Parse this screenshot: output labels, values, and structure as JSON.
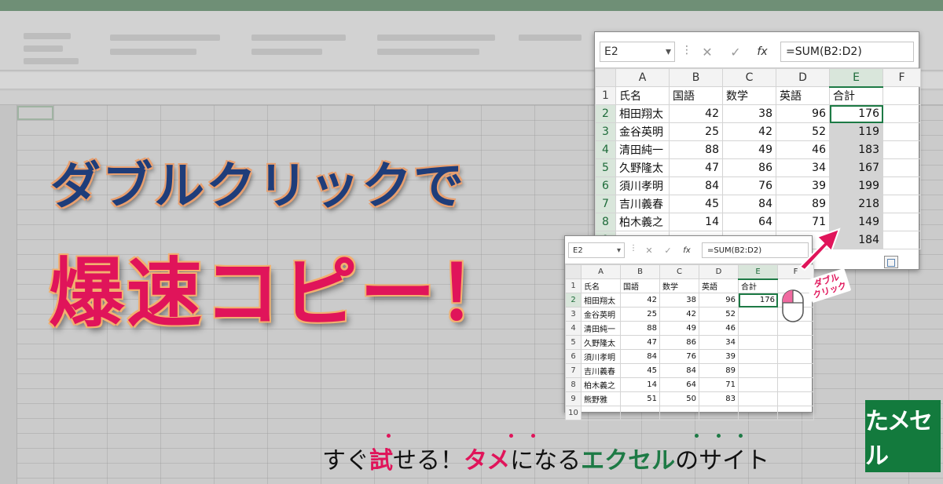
{
  "headline": {
    "line1": "ダブルクリックで",
    "line2": "爆速コピー！"
  },
  "tagline": {
    "p1": "すぐ",
    "p2": "試",
    "p3": "せる！",
    "p4": "タメ",
    "p5": "になる",
    "p6": "エクセル",
    "p7": "のサイト"
  },
  "logo": {
    "text": "たメセル"
  },
  "annotation": {
    "double_click_line1": "ダブル",
    "double_click_line2": "クリック"
  },
  "colors": {
    "accent_pink": "#e0145a",
    "excel_green": "#1d7a45",
    "headline_blue": "#1f3d7a"
  },
  "big_window": {
    "name_box": "E2",
    "formula": "=SUM(B2:D2)",
    "columns": [
      "A",
      "B",
      "C",
      "D",
      "E",
      "F"
    ],
    "header_row": [
      "氏名",
      "国語",
      "数学",
      "英語",
      "合計",
      ""
    ],
    "rows": [
      {
        "n": "1"
      },
      {
        "n": "2",
        "cells": [
          "相田翔太",
          "42",
          "38",
          "96",
          "176",
          ""
        ]
      },
      {
        "n": "3",
        "cells": [
          "金谷英明",
          "25",
          "42",
          "52",
          "119",
          ""
        ]
      },
      {
        "n": "4",
        "cells": [
          "清田純一",
          "88",
          "49",
          "46",
          "183",
          ""
        ]
      },
      {
        "n": "5",
        "cells": [
          "久野隆太",
          "47",
          "86",
          "34",
          "167",
          ""
        ]
      },
      {
        "n": "6",
        "cells": [
          "須川孝明",
          "84",
          "76",
          "39",
          "199",
          ""
        ]
      },
      {
        "n": "7",
        "cells": [
          "吉川義春",
          "45",
          "84",
          "89",
          "218",
          ""
        ]
      },
      {
        "n": "8",
        "cells": [
          "柏木義之",
          "14",
          "64",
          "71",
          "149",
          ""
        ]
      },
      {
        "n": "9",
        "cells": [
          "",
          "",
          "",
          "",
          "184",
          ""
        ]
      }
    ]
  },
  "small_window": {
    "name_box": "E2",
    "formula": "=SUM(B2:D2)",
    "columns": [
      "A",
      "B",
      "C",
      "D",
      "E",
      "F"
    ],
    "header_row": [
      "氏名",
      "国語",
      "数学",
      "英語",
      "合計",
      ""
    ],
    "rows": [
      {
        "n": "1"
      },
      {
        "n": "2",
        "cells": [
          "相田翔太",
          "42",
          "38",
          "96",
          "176",
          ""
        ]
      },
      {
        "n": "3",
        "cells": [
          "金谷英明",
          "25",
          "42",
          "52",
          "",
          ""
        ]
      },
      {
        "n": "4",
        "cells": [
          "清田純一",
          "88",
          "49",
          "46",
          "",
          ""
        ]
      },
      {
        "n": "5",
        "cells": [
          "久野隆太",
          "47",
          "86",
          "34",
          "",
          ""
        ]
      },
      {
        "n": "6",
        "cells": [
          "須川孝明",
          "84",
          "76",
          "39",
          "",
          ""
        ]
      },
      {
        "n": "7",
        "cells": [
          "吉川義春",
          "45",
          "84",
          "89",
          "",
          ""
        ]
      },
      {
        "n": "8",
        "cells": [
          "柏木義之",
          "14",
          "64",
          "71",
          "",
          ""
        ]
      },
      {
        "n": "9",
        "cells": [
          "熊野雅",
          "51",
          "50",
          "83",
          "",
          ""
        ]
      },
      {
        "n": "10",
        "cells": [
          "",
          "",
          "",
          "",
          "",
          ""
        ]
      }
    ]
  }
}
